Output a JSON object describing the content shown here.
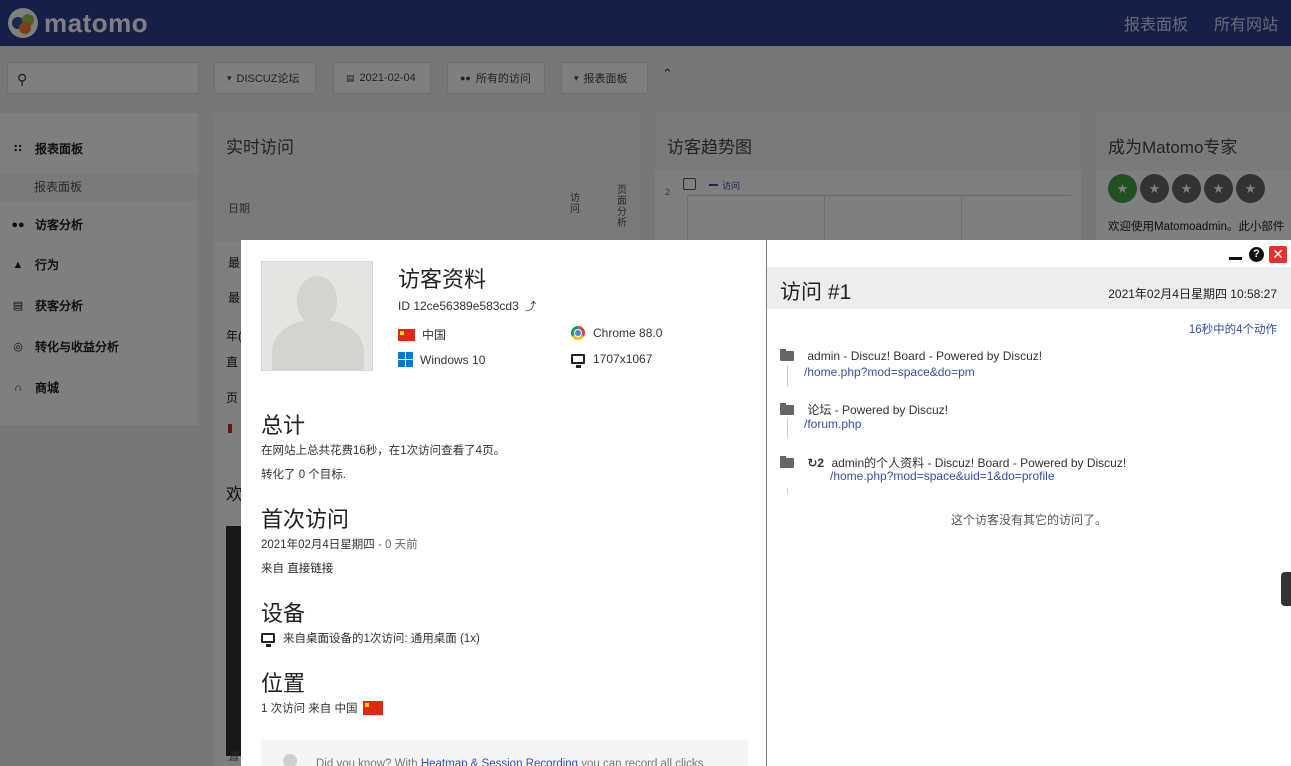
{
  "topbar": {
    "logo_text": "matomo",
    "nav": [
      "报表面板",
      "所有网站"
    ]
  },
  "toolbar": {
    "search_icon": "search-icon",
    "site_selector": "DISCUZ论坛",
    "date_selector": "2021-02-04",
    "segment_selector": "所有的访问",
    "dashboard_selector": "报表面板"
  },
  "sidebar": {
    "items": [
      {
        "label": "报表面板",
        "icon": "dashboard-icon"
      },
      {
        "label": "访客分析",
        "icon": "binoculars-icon"
      },
      {
        "label": "行为",
        "icon": "behaviour-icon"
      },
      {
        "label": "获客分析",
        "icon": "acquisition-icon"
      },
      {
        "label": "转化与收益分析",
        "icon": "goals-icon"
      },
      {
        "label": "商城",
        "icon": "ecommerce-icon"
      }
    ],
    "sub_item": "报表面板"
  },
  "widgets": {
    "realtime": {
      "title": "实时访问",
      "col_date": "日期",
      "col_visits": "访问",
      "col_actions": "页面分析",
      "rows": [
        "最",
        "最",
        "年(",
        "直",
        "页"
      ]
    },
    "trend": {
      "title": "访客趋势图",
      "axis_value": "2",
      "legend": "访问"
    },
    "expert": {
      "title": "成为Matomo专家",
      "text": "欢迎使用Matomoadmin。此小部件"
    },
    "welcome_partial": "欢",
    "bottom_partial": "直"
  },
  "profile": {
    "title": "访客资料",
    "visitor_id": "ID 12ce56389e583cd3",
    "country": "中国",
    "browser": "Chrome 88.0",
    "os": "Windows 10",
    "resolution": "1707x1067",
    "summary_heading": "总计",
    "summary_line1": "在网站上总共花费16秒，在1次访问查看了4页。",
    "summary_line2": "转化了 0 个目标.",
    "first_visit_heading": "首次访问",
    "first_visit_date": "2021年02月4日星期四",
    "first_visit_ago": " - 0 天前",
    "first_visit_from_prefix": "来自 ",
    "first_visit_from_value": "直接链接",
    "device_heading": "设备",
    "device_prefix": "来自",
    "device_bold": "桌面",
    "device_rest": "设备的1次访问: 通用桌面 (1x)",
    "location_heading": "位置",
    "location_text": "1 次访问 来自 中国",
    "did_you_know_prefix": "Did you know? With ",
    "did_you_know_link": "Heatmap & Session Recording",
    "did_you_know_suffix": " you can record all clicks"
  },
  "visit": {
    "title": "访问 #1",
    "datetime": "2021年02月4日星期四 10:58:27",
    "actions_summary": "16秒中的4个动作",
    "actions": [
      {
        "title": "admin - Discuz! Board - Powered by Discuz!",
        "url": "/home.php?mod=space&do=pm"
      },
      {
        "title": "论坛 - Powered by Discuz!",
        "url": "/forum.php"
      },
      {
        "repeat": "2",
        "title": "admin的个人资料 - Discuz! Board - Powered by Discuz!",
        "url": "/home.php?mod=space&uid=1&do=profile"
      }
    ],
    "no_other_visits": "这个访客没有其它的访问了。"
  },
  "colors": {
    "topbar": "#2d3f8f",
    "link": "#3450a3",
    "close": "#e2332e",
    "star_active": "#43a047"
  }
}
